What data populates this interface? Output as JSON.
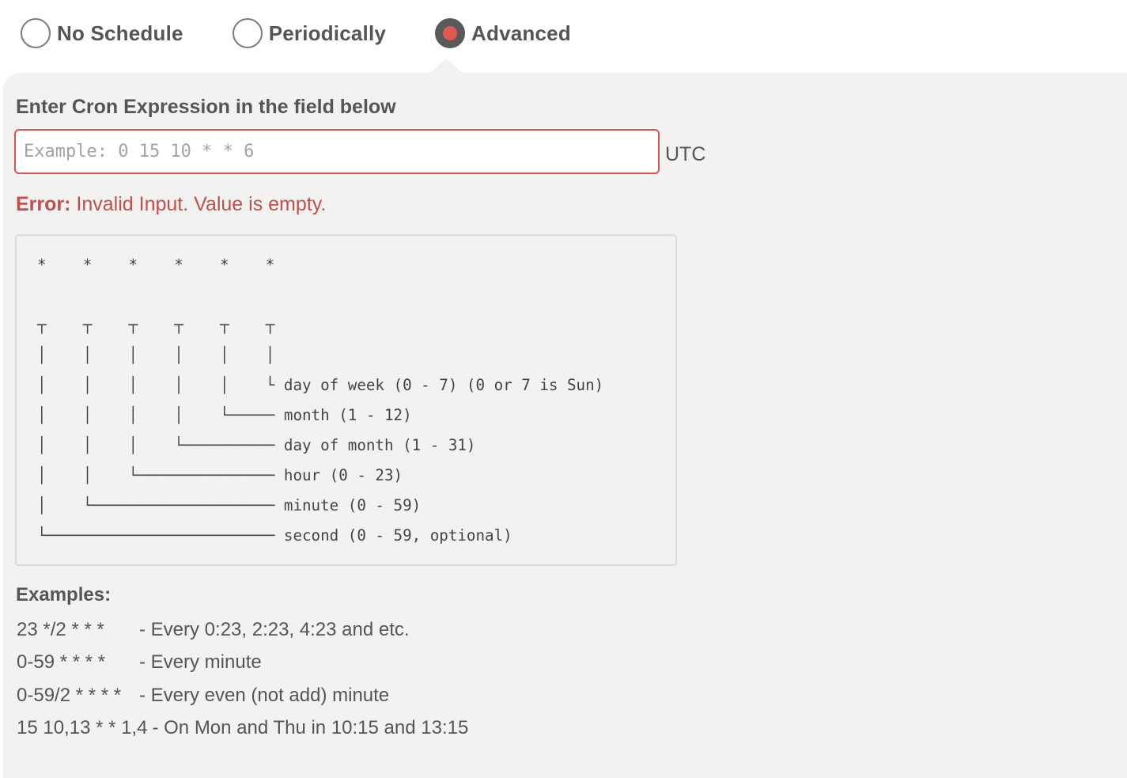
{
  "schedule": {
    "options": [
      {
        "label": "No Schedule",
        "checked": false
      },
      {
        "label": "Periodically",
        "checked": false
      },
      {
        "label": "Advanced",
        "checked": true
      }
    ]
  },
  "cron": {
    "instruction": "Enter Cron Expression in the field below",
    "value": "",
    "placeholder": "Example: 0 15 10 * * 6",
    "timezone": "UTC",
    "error_prefix": "Error:",
    "error_message": " Invalid Input. Value is empty."
  },
  "diagram": {
    "lines": [
      "*    *    *    *    *    *",
      "",
      "┬    ┬    ┬    ┬    ┬    ┬",
      "│    │    │    │    │    │",
      "│    │    │    │    │    └ day of week (0 - 7) (0 or 7 is Sun)",
      "│    │    │    │    └───── month (1 - 12)",
      "│    │    │    └────────── day of month (1 - 31)",
      "│    │    └─────────────── hour (0 - 23)",
      "│    └──────────────────── minute (0 - 59)",
      "└───────────────────────── second (0 - 59, optional)"
    ]
  },
  "examples": {
    "title": "Examples:",
    "items": [
      {
        "expr": "23 */2 * * *",
        "desc": "- Every 0:23, 2:23, 4:23 and etc."
      },
      {
        "expr": "0-59 * * * *",
        "desc": "- Every minute"
      },
      {
        "expr": "0-59/2 * * * *",
        "desc": "- Every even (not add) minute"
      },
      {
        "expr": "15 10,13 * * 1,4",
        "desc": "- On Mon and Thu in 10:15 and 13:15"
      }
    ]
  },
  "colors": {
    "accent": "#e05a4f",
    "error": "#c0504d",
    "panel": "#f2f2f1"
  }
}
